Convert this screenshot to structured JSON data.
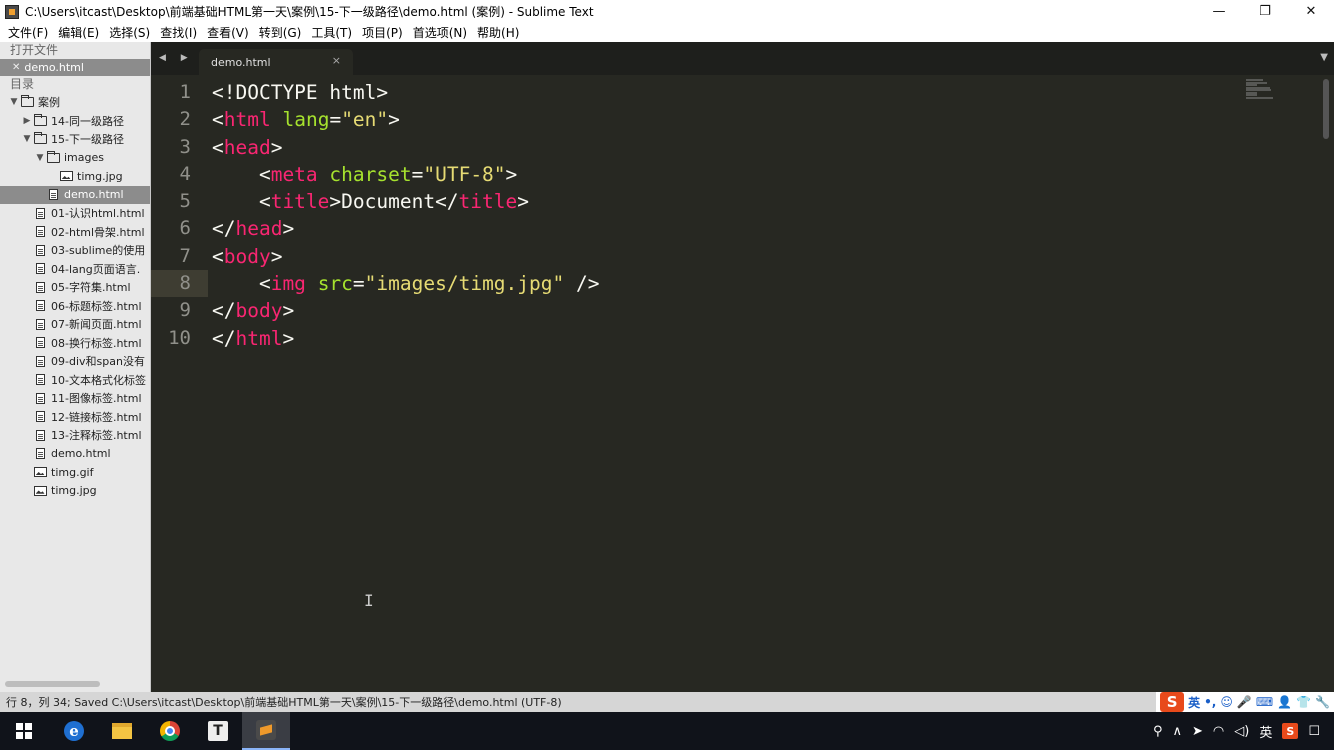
{
  "window": {
    "title": "C:\\Users\\itcast\\Desktop\\前端基础HTML第一天\\案例\\15-下一级路径\\demo.html (案例) - Sublime Text",
    "minimize": "—",
    "maximize": "❐",
    "close": "✕"
  },
  "menu": [
    "文件(F)",
    "编辑(E)",
    "选择(S)",
    "查找(I)",
    "查看(V)",
    "转到(G)",
    "工具(T)",
    "项目(P)",
    "首选项(N)",
    "帮助(H)"
  ],
  "sidebar": {
    "open_files_header": "打开文件",
    "open_file": "demo.html",
    "folders_header": "目录",
    "tree": [
      {
        "label": "案例",
        "type": "folder",
        "depth": 0,
        "arrow": "▼"
      },
      {
        "label": "14-同一级路径",
        "type": "folder",
        "depth": 1,
        "arrow": "▶"
      },
      {
        "label": "15-下一级路径",
        "type": "folder",
        "depth": 1,
        "arrow": "▼"
      },
      {
        "label": "images",
        "type": "folder",
        "depth": 2,
        "arrow": "▼"
      },
      {
        "label": "timg.jpg",
        "type": "image",
        "depth": 3,
        "arrow": ""
      },
      {
        "label": "demo.html",
        "type": "file",
        "depth": 2,
        "arrow": "",
        "selected": true
      },
      {
        "label": "01-认识html.html",
        "type": "file",
        "depth": 1,
        "arrow": ""
      },
      {
        "label": "02-html骨架.html",
        "type": "file",
        "depth": 1,
        "arrow": ""
      },
      {
        "label": "03-sublime的使用",
        "type": "file",
        "depth": 1,
        "arrow": ""
      },
      {
        "label": "04-lang页面语言.",
        "type": "file",
        "depth": 1,
        "arrow": ""
      },
      {
        "label": "05-字符集.html",
        "type": "file",
        "depth": 1,
        "arrow": ""
      },
      {
        "label": "06-标题标签.html",
        "type": "file",
        "depth": 1,
        "arrow": ""
      },
      {
        "label": "07-新闻页面.html",
        "type": "file",
        "depth": 1,
        "arrow": ""
      },
      {
        "label": "08-换行标签.html",
        "type": "file",
        "depth": 1,
        "arrow": ""
      },
      {
        "label": "09-div和span没有",
        "type": "file",
        "depth": 1,
        "arrow": ""
      },
      {
        "label": "10-文本格式化标签",
        "type": "file",
        "depth": 1,
        "arrow": ""
      },
      {
        "label": "11-图像标签.html",
        "type": "file",
        "depth": 1,
        "arrow": ""
      },
      {
        "label": "12-链接标签.html",
        "type": "file",
        "depth": 1,
        "arrow": ""
      },
      {
        "label": "13-注释标签.html",
        "type": "file",
        "depth": 1,
        "arrow": ""
      },
      {
        "label": "demo.html",
        "type": "file",
        "depth": 1,
        "arrow": ""
      },
      {
        "label": "timg.gif",
        "type": "image",
        "depth": 1,
        "arrow": ""
      },
      {
        "label": "timg.jpg",
        "type": "image",
        "depth": 1,
        "arrow": ""
      }
    ]
  },
  "tabs": {
    "nav": "◀ ▶",
    "active_tab": "demo.html",
    "close": "×",
    "dropdown": "▼"
  },
  "editor": {
    "active_line": 8,
    "lines": [
      [
        {
          "t": "<!DOCTYPE html>",
          "c": ""
        }
      ],
      [
        {
          "t": "<",
          "c": ""
        },
        {
          "t": "html",
          "c": "tg"
        },
        {
          "t": " ",
          "c": ""
        },
        {
          "t": "lang",
          "c": "at"
        },
        {
          "t": "=",
          "c": ""
        },
        {
          "t": "\"en\"",
          "c": "st"
        },
        {
          "t": ">",
          "c": ""
        }
      ],
      [
        {
          "t": "<",
          "c": ""
        },
        {
          "t": "head",
          "c": "tg"
        },
        {
          "t": ">",
          "c": ""
        }
      ],
      [
        {
          "t": "    <",
          "c": ""
        },
        {
          "t": "meta",
          "c": "tg"
        },
        {
          "t": " ",
          "c": ""
        },
        {
          "t": "charset",
          "c": "at"
        },
        {
          "t": "=",
          "c": ""
        },
        {
          "t": "\"UTF-8\"",
          "c": "st"
        },
        {
          "t": ">",
          "c": ""
        }
      ],
      [
        {
          "t": "    <",
          "c": ""
        },
        {
          "t": "title",
          "c": "tg"
        },
        {
          "t": ">Document</",
          "c": ""
        },
        {
          "t": "title",
          "c": "tg"
        },
        {
          "t": ">",
          "c": ""
        }
      ],
      [
        {
          "t": "</",
          "c": ""
        },
        {
          "t": "head",
          "c": "tg"
        },
        {
          "t": ">",
          "c": ""
        }
      ],
      [
        {
          "t": "<",
          "c": ""
        },
        {
          "t": "body",
          "c": "tg"
        },
        {
          "t": ">",
          "c": ""
        }
      ],
      [
        {
          "t": "    <",
          "c": ""
        },
        {
          "t": "img",
          "c": "tg"
        },
        {
          "t": " ",
          "c": ""
        },
        {
          "t": "src",
          "c": "at"
        },
        {
          "t": "=",
          "c": ""
        },
        {
          "t": "\"images/timg.jpg\"",
          "c": "st"
        },
        {
          "t": " />",
          "c": ""
        }
      ],
      [
        {
          "t": "</",
          "c": ""
        },
        {
          "t": "body",
          "c": "tg"
        },
        {
          "t": ">",
          "c": ""
        }
      ],
      [
        {
          "t": "</",
          "c": ""
        },
        {
          "t": "html",
          "c": "tg"
        },
        {
          "t": ">",
          "c": ""
        }
      ]
    ]
  },
  "status": {
    "text": "行 8，列 34; Saved C:\\Users\\itcast\\Desktop\\前端基础HTML第一天\\案例\\15-下一级路径\\demo.html (UTF-8)"
  },
  "ime": {
    "logo": "S",
    "lang": "英",
    "items": [
      "•,",
      "☺",
      "🎤",
      "⌨",
      "👤",
      "👕",
      "🔧"
    ]
  },
  "taskbar": {
    "typora": "T",
    "edge": "e",
    "tray": {
      "people": "⚲",
      "chevron": "∧",
      "send": "➤",
      "wifi": "◠",
      "volume": "◁)",
      "ime": "英",
      "sogou": "S",
      "notifications": "☐"
    }
  },
  "colors": {
    "editor_bg": "#272822",
    "tag": "#f92672",
    "attribute": "#a6e22e",
    "string": "#e6db74"
  }
}
